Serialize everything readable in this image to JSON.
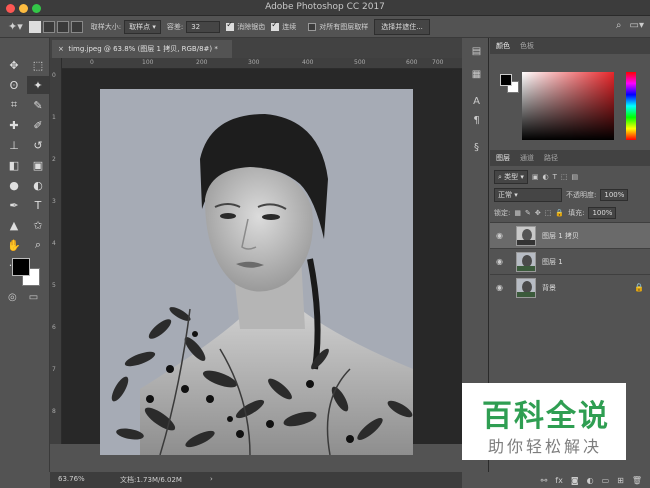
{
  "window": {
    "title": "Adobe Photoshop CC 2017"
  },
  "options": {
    "sample_size_label": "取样大小:",
    "sample_size_value": "取样点",
    "tolerance_label": "容差:",
    "tolerance_value": "32",
    "anti_alias_label": "消除锯齿",
    "contiguous_label": "连续",
    "sample_all_label": "对所有图层取样",
    "select_mask_label": "选择并遮住..."
  },
  "document": {
    "tab_label": "timg.jpeg @ 63.8% (图层 1 拷贝, RGB/8#) *",
    "ruler_h": [
      "0",
      "100",
      "200",
      "300",
      "400",
      "500",
      "600",
      "700",
      "800"
    ],
    "ruler_v": [
      "0",
      "1",
      "2",
      "3",
      "4",
      "5",
      "6",
      "7",
      "8",
      "9"
    ],
    "zoom": "63.76%",
    "doc_size": "文档:1.73M/6.02M"
  },
  "panels": {
    "color_tabs": [
      "颜色",
      "色板"
    ],
    "layer_tabs": [
      "图层",
      "通道",
      "路径"
    ],
    "filter_kind": "类型",
    "blend_mode": "正常",
    "opacity_label": "不透明度:",
    "opacity_value": "100%",
    "lock_label": "锁定:",
    "fill_label": "填充:",
    "fill_value": "100%",
    "layers": [
      {
        "name": "图层 1 拷贝",
        "selected": true
      },
      {
        "name": "图层 1",
        "selected": false
      },
      {
        "name": "背景",
        "selected": false
      }
    ]
  },
  "watermark": {
    "title": "百科全说",
    "subtitle": "助你轻松解决"
  },
  "colors": {
    "accent_green": "#2f9e52",
    "panel_bg": "#535353"
  }
}
